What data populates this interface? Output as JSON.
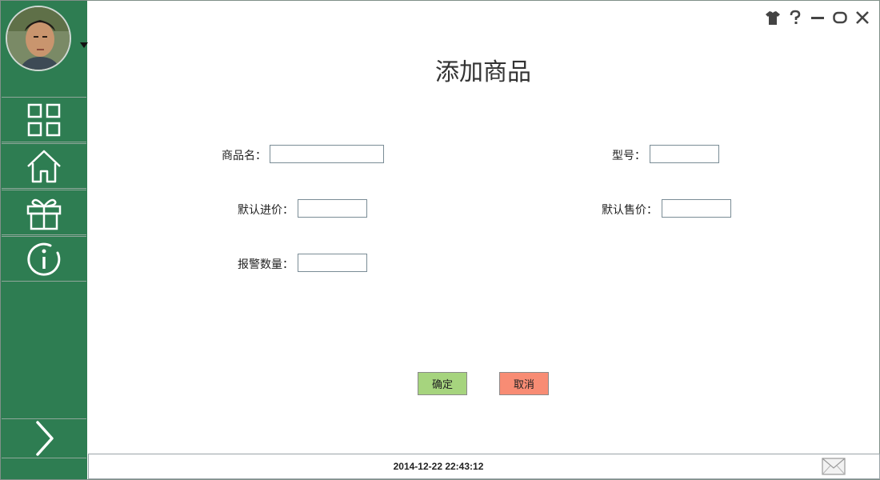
{
  "window": {
    "controls": {
      "skin_icon": "tshirt-icon",
      "help_icon": "help-icon",
      "minimize_icon": "minimize-icon",
      "maximize_icon": "maximize-icon",
      "close_icon": "close-icon"
    }
  },
  "sidebar": {
    "items": [
      {
        "icon": "grid-icon"
      },
      {
        "icon": "home-icon"
      },
      {
        "icon": "gift-icon"
      },
      {
        "icon": "info-icon"
      }
    ],
    "expand_icon": "chevron-right-icon"
  },
  "page": {
    "title": "添加商品"
  },
  "form": {
    "name_label": "商品名：",
    "model_label": "型号：",
    "cost_label": "默认进价：",
    "price_label": "默认售价：",
    "alert_label": "报警数量：",
    "name_value": "",
    "model_value": "",
    "cost_value": "",
    "price_value": "",
    "alert_value": ""
  },
  "actions": {
    "ok_label": "确定",
    "cancel_label": "取消"
  },
  "status": {
    "datetime": "2014-12-22 22:43:12"
  },
  "colors": {
    "sidebar": "#2e7d52",
    "ok_button": "#a6d47e",
    "cancel_button": "#f88c74"
  }
}
